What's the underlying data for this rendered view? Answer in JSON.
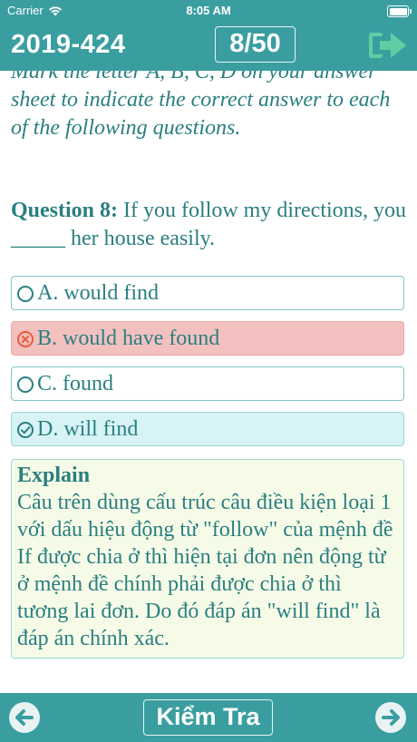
{
  "status_bar": {
    "carrier": "Carrier",
    "time": "8:05 AM"
  },
  "header": {
    "exam_code": "2019-424",
    "question_counter": "8/50",
    "exit_icon": "exit-icon"
  },
  "instruction": {
    "text": "Mark the letter A, B, C, D on your answer sheet to indicate the correct answer to each of the following questions."
  },
  "question": {
    "label": "Question 8:",
    "text": " If you follow my directions, you _____ her house easily."
  },
  "options": [
    {
      "label": "A. would find",
      "state": "unselected",
      "icon": "circle-icon"
    },
    {
      "label": "B. would have found",
      "state": "wrong",
      "icon": "x-circle-icon"
    },
    {
      "label": "C. found",
      "state": "unselected",
      "icon": "circle-icon"
    },
    {
      "label": "D. will find",
      "state": "correct",
      "icon": "check-circle-icon"
    }
  ],
  "explain": {
    "title": "Explain",
    "body": "Câu trên dùng cấu trúc câu điều kiện loại 1 với dấu hiệu động từ \"follow\" của mệnh đề If được chia ở thì hiện tại đơn nên động từ ở mệnh đề chính phải được chia ở thì tương lai đơn. Do đó đáp án \"will find\" là đáp án chính xác."
  },
  "footer": {
    "check_label": "Kiểm Tra",
    "prev_icon": "arrow-left-icon",
    "next_icon": "arrow-right-icon"
  },
  "colors": {
    "teal": "#3a9ea0",
    "text": "#2a7f80",
    "wrong_bg": "#f3c0c0",
    "correct_bg": "#d7f3f5",
    "explain_bg": "#f6fbe8"
  }
}
